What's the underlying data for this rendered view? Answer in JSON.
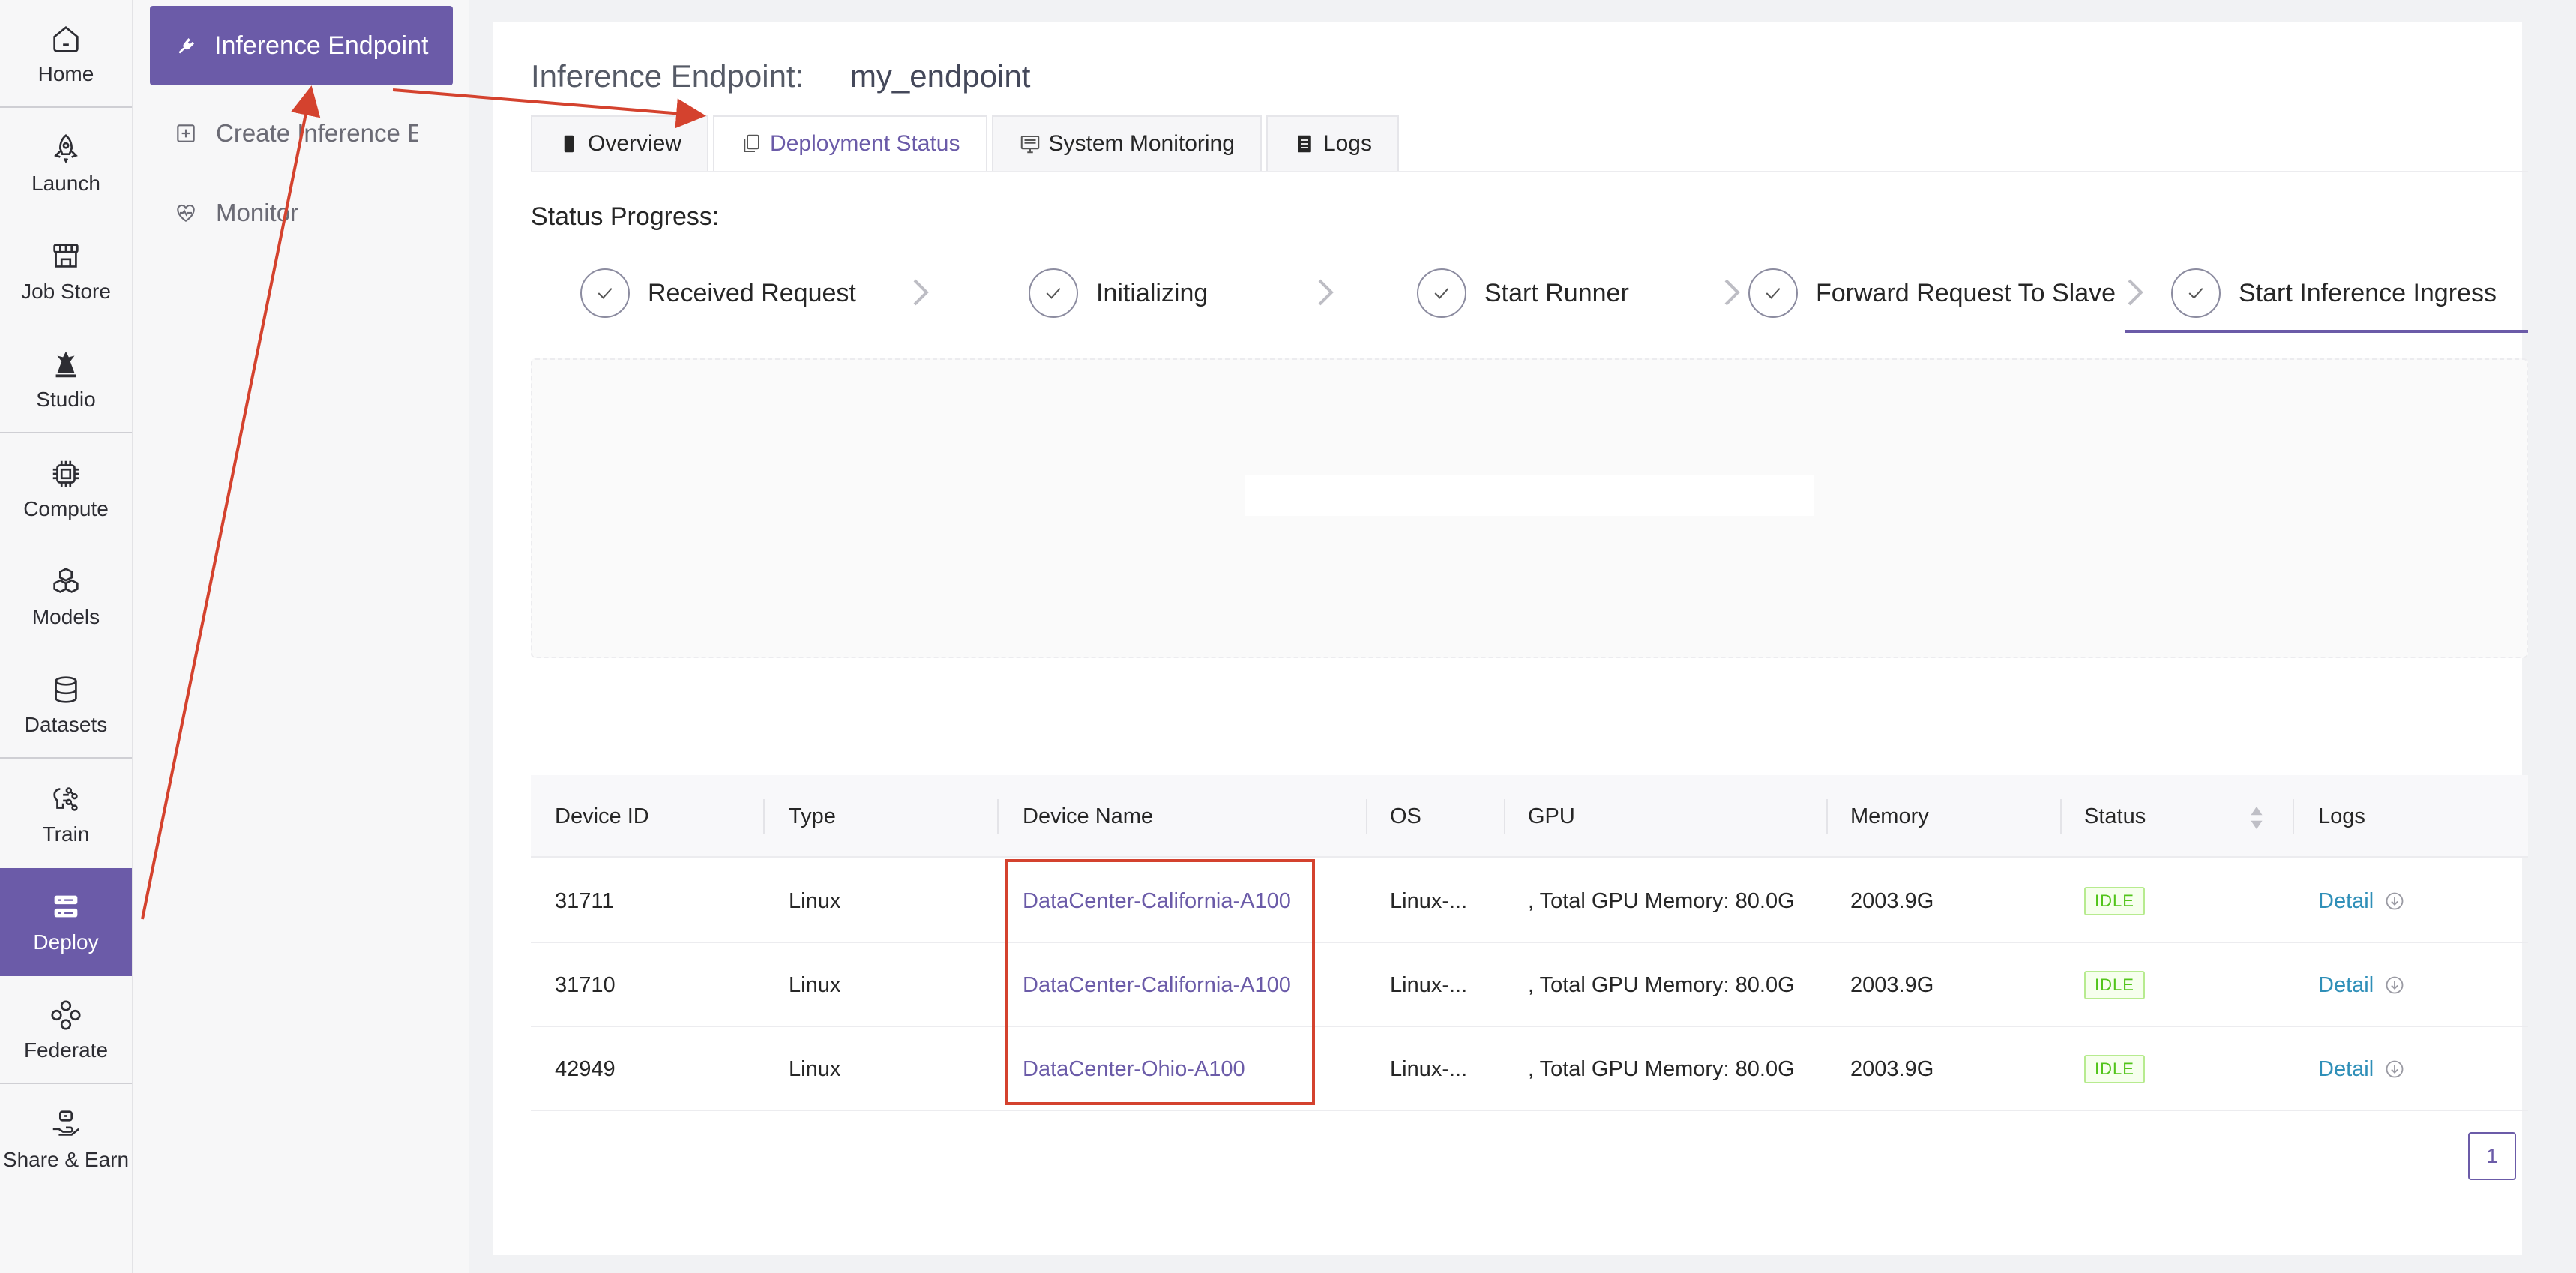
{
  "rail": {
    "items": [
      {
        "label": "Home",
        "icon": "home-icon"
      },
      {
        "label": "Launch",
        "icon": "rocket-icon"
      },
      {
        "label": "Job Store",
        "icon": "store-icon"
      },
      {
        "label": "Studio",
        "icon": "studio-icon"
      },
      {
        "label": "Compute",
        "icon": "chip-icon"
      },
      {
        "label": "Models",
        "icon": "cubes-icon"
      },
      {
        "label": "Datasets",
        "icon": "database-icon"
      },
      {
        "label": "Train",
        "icon": "train-icon"
      },
      {
        "label": "Deploy",
        "icon": "server-icon"
      },
      {
        "label": "Federate",
        "icon": "federate-icon"
      },
      {
        "label": "Share & Earn",
        "icon": "share-earn-icon"
      }
    ],
    "active": "Deploy"
  },
  "subnav": {
    "active_label": "Inference Endpoint",
    "items": [
      {
        "label": "Create Inference Endpoint",
        "icon": "plus-square-icon"
      },
      {
        "label": "Monitor",
        "icon": "heart-monitor-icon"
      }
    ]
  },
  "page": {
    "title_label": "Inference Endpoint:",
    "title_value": "my_endpoint"
  },
  "tabs": [
    {
      "label": "Overview",
      "icon": "phone-icon"
    },
    {
      "label": "Deployment Status",
      "icon": "copy-icon",
      "active": true
    },
    {
      "label": "System Monitoring",
      "icon": "monitor-icon"
    },
    {
      "label": "Logs",
      "icon": "document-icon"
    }
  ],
  "status": {
    "label": "Status Progress:",
    "steps": [
      "Received Request",
      "Initializing",
      "Start Runner",
      "Forward Request To Slave",
      "Start Inference Ingress"
    ]
  },
  "table": {
    "columns": [
      "Device ID",
      "Type",
      "Device Name",
      "OS",
      "GPU",
      "Memory",
      "Status",
      "Logs"
    ],
    "rows": [
      {
        "device_id": "31711",
        "type": "Linux",
        "device_name": "DataCenter-California-A100",
        "os": "Linux-...",
        "gpu": ", Total GPU Memory: 80.0G",
        "memory": "2003.9G",
        "status": "IDLE",
        "logs": "Detail"
      },
      {
        "device_id": "31710",
        "type": "Linux",
        "device_name": "DataCenter-California-A100",
        "os": "Linux-...",
        "gpu": ", Total GPU Memory: 80.0G",
        "memory": "2003.9G",
        "status": "IDLE",
        "logs": "Detail"
      },
      {
        "device_id": "42949",
        "type": "Linux",
        "device_name": "DataCenter-Ohio-A100",
        "os": "Linux-...",
        "gpu": ", Total GPU Memory: 80.0G",
        "memory": "2003.9G",
        "status": "IDLE",
        "logs": "Detail"
      }
    ]
  },
  "pagination": {
    "current_page": "1"
  },
  "colors": {
    "accent": "#6b5ba8",
    "annotation": "#d4422e",
    "link": "#2f8fb8",
    "status_idle": "#52c41a"
  }
}
